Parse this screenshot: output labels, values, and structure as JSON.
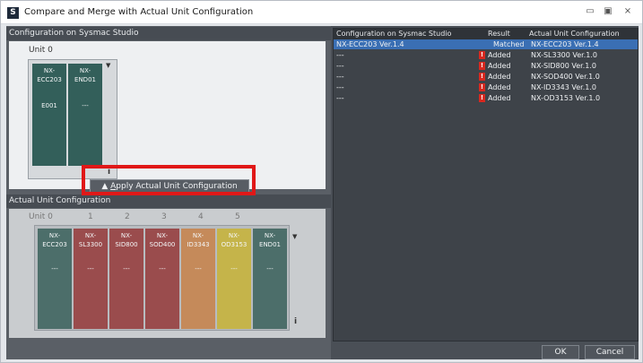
{
  "window": {
    "title": "Compare and Merge with Actual Unit Configuration",
    "app_icon": "S",
    "controls": {
      "minimize": "▭",
      "maximize": "▣",
      "close": "⨯"
    }
  },
  "left": {
    "studio_header": "Configuration on Sysmac Studio",
    "studio_unit_label": "Unit 0",
    "studio_modules": [
      {
        "line1": "NX-",
        "line2": "ECC203",
        "extra": "E001",
        "color": "#335f5a"
      },
      {
        "line1": "NX-",
        "line2": "END01",
        "extra": "---",
        "color": "#335f5a"
      }
    ],
    "apply_button": {
      "arrow": "▲",
      "label_first": "A",
      "label_rest": "pply Actual Unit Configuration"
    },
    "actual_header": "Actual Unit Configuration",
    "actual_unit_numbers": [
      "Unit 0",
      "1",
      "2",
      "3",
      "4",
      "5"
    ],
    "actual_modules": [
      {
        "line1": "NX-",
        "line2": "ECC203",
        "extra": "---",
        "color": "#4c6e6a"
      },
      {
        "line1": "NX-",
        "line2": "SL3300",
        "extra": "---",
        "color": "#9a4c4d"
      },
      {
        "line1": "NX-",
        "line2": "SID800",
        "extra": "---",
        "color": "#9a4c4d"
      },
      {
        "line1": "NX-",
        "line2": "SOD400",
        "extra": "---",
        "color": "#9a4c4d"
      },
      {
        "line1": "NX-",
        "line2": "ID3343",
        "extra": "---",
        "color": "#c58a5a"
      },
      {
        "line1": "NX-",
        "line2": "OD3153",
        "extra": "---",
        "color": "#c5b44a"
      },
      {
        "line1": "NX-",
        "line2": "END01",
        "extra": "---",
        "color": "#4c6e6a"
      }
    ],
    "scroll_marker": "▼",
    "info_marker": "i"
  },
  "compare_table": {
    "headers": [
      "Configuration on Sysmac Studio",
      "Result",
      "Actual Unit Configuration"
    ],
    "rows": [
      {
        "studio": "NX-ECC203 Ver.1.4",
        "warn": "",
        "result": "Matched",
        "actual": "NX-ECC203 Ver.1.4",
        "selected": true
      },
      {
        "studio": "---",
        "warn": "!",
        "result": "Added",
        "actual": "NX-SL3300 Ver.1.0",
        "selected": false
      },
      {
        "studio": "---",
        "warn": "!",
        "result": "Added",
        "actual": "NX-SID800 Ver.1.0",
        "selected": false
      },
      {
        "studio": "---",
        "warn": "!",
        "result": "Added",
        "actual": "NX-SOD400 Ver.1.0",
        "selected": false
      },
      {
        "studio": "---",
        "warn": "!",
        "result": "Added",
        "actual": "NX-ID3343 Ver.1.0",
        "selected": false
      },
      {
        "studio": "---",
        "warn": "!",
        "result": "Added",
        "actual": "NX-OD3153 Ver.1.0",
        "selected": false
      }
    ]
  },
  "footer": {
    "ok": "OK",
    "cancel": "Cancel"
  },
  "colors": {
    "highlight": "#e01818",
    "selected_row": "#3a6fb4",
    "warning": "#d8281f"
  }
}
